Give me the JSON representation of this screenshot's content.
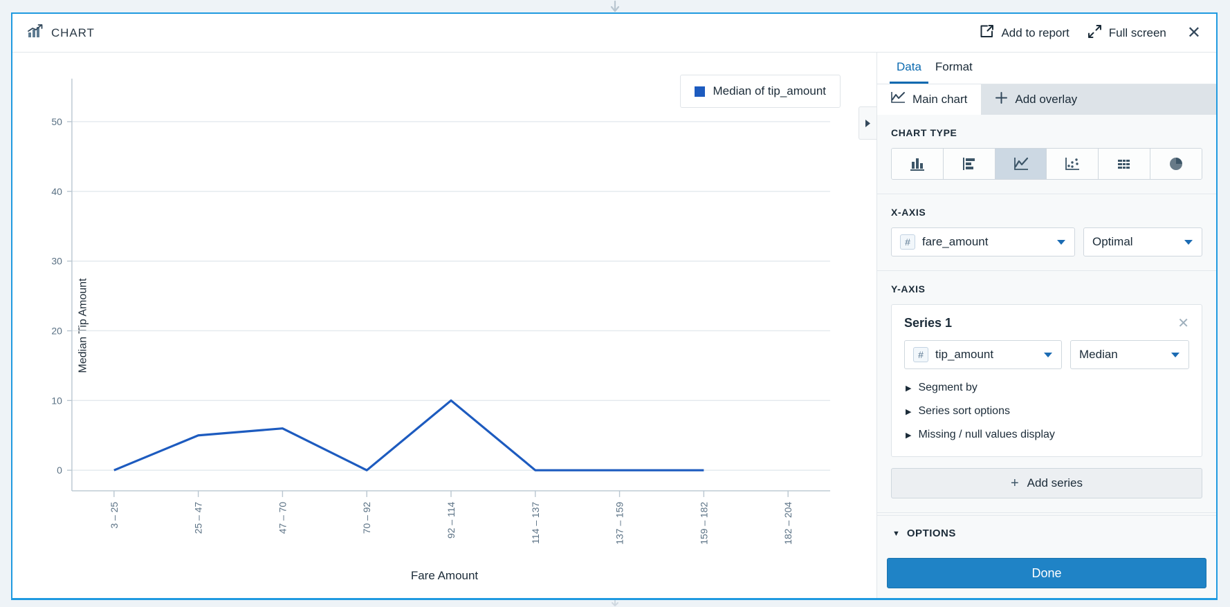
{
  "window": {
    "title": "CHART",
    "title_icon": "chart-icon",
    "actions": [
      {
        "label": "Add to report",
        "icon": "external-link-icon"
      },
      {
        "label": "Full screen",
        "icon": "expand-icon"
      }
    ],
    "close_label": "✕"
  },
  "chart_data": {
    "type": "line",
    "title": "",
    "xlabel": "Fare Amount",
    "ylabel": "Median Tip Amount",
    "categories": [
      "3 – 25",
      "25 – 47",
      "47 – 70",
      "70 – 92",
      "92 – 114",
      "114 – 137",
      "137 – 159",
      "159 – 182",
      "182 – 204"
    ],
    "values": [
      0,
      5,
      6,
      0,
      10,
      0,
      0,
      0,
      null
    ],
    "series": [
      {
        "name": "Median of tip_amount",
        "color": "#1d5bbf",
        "values": [
          0,
          5,
          6,
          0,
          10,
          0,
          0,
          0,
          null
        ]
      }
    ],
    "ylim": [
      0,
      54
    ],
    "yticks": [
      0,
      10,
      20,
      30,
      40,
      50
    ],
    "grid": true,
    "legend": {
      "position": "top-right",
      "entries": [
        "Median of tip_amount"
      ]
    }
  },
  "legend": {
    "label": "Median of tip_amount",
    "color": "#1d5bbf"
  },
  "collapse_tab": {
    "icon": "triangle-right-icon"
  },
  "panel": {
    "tabs": [
      {
        "label": "Data",
        "active": true
      },
      {
        "label": "Format",
        "active": false
      }
    ],
    "subtabs": [
      {
        "label": "Main chart",
        "icon": "line-chart-icon",
        "active": true
      },
      {
        "label": "Add overlay",
        "icon": "plus-icon",
        "active": false
      }
    ],
    "chart_type": {
      "title": "CHART TYPE",
      "options": [
        {
          "name": "column-chart-icon",
          "active": false
        },
        {
          "name": "bar-chart-icon",
          "active": false
        },
        {
          "name": "line-chart-icon",
          "active": true
        },
        {
          "name": "scatter-chart-icon",
          "active": false
        },
        {
          "name": "table-icon",
          "active": false
        },
        {
          "name": "pie-chart-icon",
          "active": false
        }
      ]
    },
    "x_axis": {
      "title": "X-AXIS",
      "field": "fare_amount",
      "field_type_icon": "number-field-icon",
      "binning": "Optimal"
    },
    "y_axis": {
      "title": "Y-AXIS",
      "series": {
        "name": "Series 1",
        "field": "tip_amount",
        "field_type_icon": "number-field-icon",
        "aggregation": "Median",
        "disclosures": [
          "Segment by",
          "Series sort options",
          "Missing / null values display"
        ],
        "remove_label": "✕"
      },
      "add_series_label": "Add series"
    },
    "options_label": "OPTIONS",
    "done_label": "Done"
  }
}
